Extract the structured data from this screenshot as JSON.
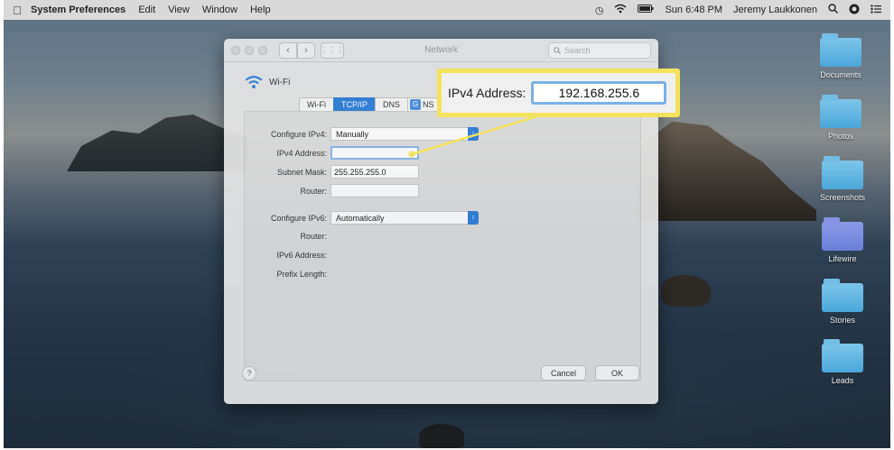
{
  "menubar": {
    "app_name": "System Preferences",
    "menus": [
      "Edit",
      "View",
      "Window",
      "Help"
    ],
    "clock": "Sun 6:48 PM",
    "user": "Jeremy Laukkonen"
  },
  "desktop": {
    "folders": [
      "Documents",
      "Photos",
      "Screenshots",
      "Lifewire",
      "Stories",
      "Leads"
    ]
  },
  "window": {
    "title": "Network",
    "search_placeholder": "Search",
    "interface_name": "Wi-Fi",
    "tabs": [
      "Wi-Fi",
      "TCP/IP",
      "DNS",
      "NS"
    ],
    "active_tab": "TCP/IP",
    "configure_ipv4_label": "Configure IPv4:",
    "configure_ipv4_value": "Manually",
    "ipv4_address_label": "IPv4 Address:",
    "subnet_mask_label": "Subnet Mask:",
    "subnet_mask_value": "255.255.255.0",
    "router_label": "Router:",
    "configure_ipv6_label": "Configure IPv6:",
    "configure_ipv6_value": "Automatically",
    "router6_label": "Router:",
    "ipv6_address_label": "IPv6 Address:",
    "prefix_length_label": "Prefix Length:",
    "help_label": "?",
    "cancel_label": "Cancel",
    "ok_label": "OK"
  },
  "callout": {
    "label": "IPv4 Address:",
    "value": "192.168.255.6",
    "border_color": "#f3e35c"
  },
  "colors": {
    "accent": "#2e7fd8",
    "highlight": "#f3e35c"
  }
}
